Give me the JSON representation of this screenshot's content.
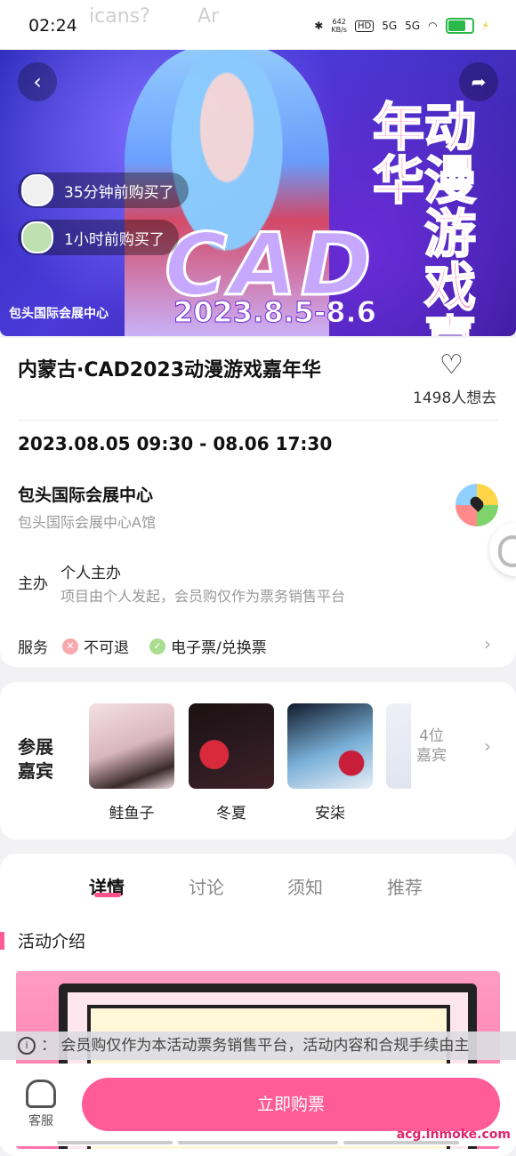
{
  "status": {
    "time": "02:24",
    "ghost_left": "icans?",
    "ghost_right": "Ar",
    "net_speed": "642",
    "net_unit": "KB/s",
    "hd": "HD",
    "sig1": "5G",
    "sig2": "5G"
  },
  "banner": {
    "side_title": "动漫游戏嘉年华",
    "cad": "CAD",
    "dates": "2023.8.5-8.6",
    "venue_tag": "包头国际会展中心",
    "recent": [
      {
        "text": "35分钟前购买了"
      },
      {
        "text": "1小时前购买了"
      }
    ]
  },
  "event": {
    "title": "内蒙古·CAD2023动漫游戏嘉年华",
    "wish_count": "1498人想去",
    "datetime": "2023.08.05 09:30 - 08.06 17:30",
    "venue": "包头国际会展中心",
    "venue_detail": "包头国际会展中心A馆",
    "organizer_label": "主办",
    "organizer_name": "个人主办",
    "organizer_desc": "项目由个人发起，会员购仅作为票务销售平台",
    "service_label": "服务",
    "services": [
      "不可退",
      "电子票/兑换票"
    ]
  },
  "guests": {
    "label": "参展嘉宾",
    "items": [
      {
        "name": "鲑鱼子"
      },
      {
        "name": "冬夏"
      },
      {
        "name": "安柒"
      }
    ],
    "more": "4位嘉宾"
  },
  "tabs": [
    "详情",
    "讨论",
    "须知",
    "推荐"
  ],
  "section_title": "活动介绍",
  "notice": "会员购仅作为本活动票务销售平台，活动内容和合规手续由主",
  "bottom": {
    "service_label": "客服",
    "buy_label": "立即购票"
  },
  "watermark": "acg.inmoke.com",
  "colors": {
    "accent": "#ff5c97",
    "banner": "#3a2bc8"
  }
}
